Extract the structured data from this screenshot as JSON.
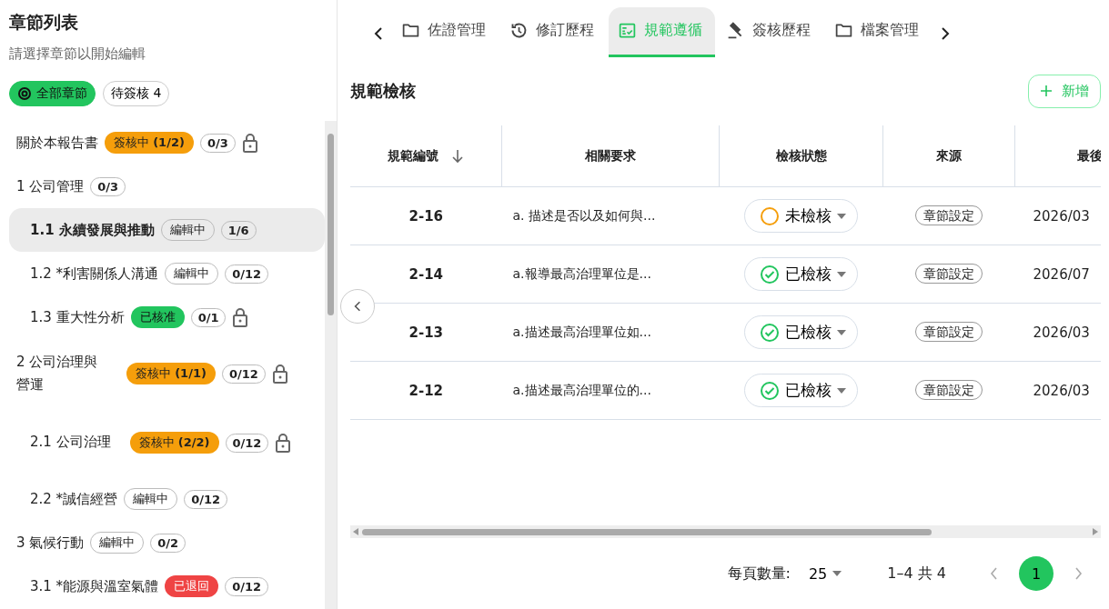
{
  "sidebar": {
    "title": "章節列表",
    "subtitle": "請選擇章節以開始編輯",
    "filters": [
      {
        "label": "全部章節",
        "selected": true
      },
      {
        "label": "待簽核 4",
        "selected": false
      }
    ],
    "items": [
      {
        "title": "關於本報告書",
        "status": {
          "kind": "signing",
          "text": "簽核中 **(1/2)**"
        },
        "count": "0/3",
        "locked": true,
        "selected": false
      },
      {
        "title": "1 公司管理",
        "count": "0/3",
        "locked": false,
        "selected": false,
        "children": [
          {
            "title": "1.1 永續發展與推動",
            "status": {
              "kind": "editing",
              "text": "編輯中"
            },
            "count": "1/6",
            "locked": false,
            "selected": true
          },
          {
            "title": "1.2 *利害關係人溝通",
            "status": {
              "kind": "editing",
              "text": "編輯中"
            },
            "count": "0/12",
            "locked": false,
            "selected": false
          },
          {
            "title": "1.3 重大性分析",
            "status": {
              "kind": "approved",
              "text": "已核准"
            },
            "count": "0/1",
            "locked": true,
            "selected": false
          }
        ]
      },
      {
        "title": "2 公司治理與營運",
        "status": {
          "kind": "signing",
          "text": "簽核中 **(1/1)**"
        },
        "count": "0/12",
        "locked": true,
        "selected": false,
        "children": [
          {
            "title": "2.1 公司治理",
            "status": {
              "kind": "signing",
              "text": "簽核中 **(2/2)**"
            },
            "count": "0/12",
            "locked": true,
            "selected": false
          },
          {
            "title": "2.2 *誠信經營",
            "status": {
              "kind": "editing",
              "text": "編輯中"
            },
            "count": "0/12",
            "locked": false,
            "selected": false
          }
        ]
      },
      {
        "title": "3 氣候行動",
        "status": {
          "kind": "editing",
          "text": "編輯中"
        },
        "count": "0/2",
        "locked": false,
        "selected": false,
        "children": [
          {
            "title": "3.1 *能源與溫室氣體",
            "status": {
              "kind": "returned",
              "text": "已退回"
            },
            "count": "0/12",
            "locked": false,
            "selected": false
          }
        ]
      }
    ]
  },
  "tabs": [
    {
      "label": "佐證管理",
      "selected": false
    },
    {
      "label": "修訂歷程",
      "selected": false
    },
    {
      "label": "規範遵循",
      "selected": true
    },
    {
      "label": "簽核歷程",
      "selected": false
    },
    {
      "label": "檔案管理",
      "selected": false
    }
  ],
  "section": {
    "title": "規範檢核",
    "add_button": "新增"
  },
  "table": {
    "columns": [
      "規範編號",
      "相關要求",
      "檢核狀態",
      "來源",
      "最後"
    ],
    "rows": [
      {
        "code": "2-16",
        "requirement": "a. 描述是否以及如何與...",
        "status": {
          "checked": false,
          "text": "未檢核"
        },
        "source": "章節設定",
        "date": "2026/03"
      },
      {
        "code": "2-14",
        "requirement": "a.報導最高治理單位是...",
        "status": {
          "checked": true,
          "text": "已檢核"
        },
        "source": "章節設定",
        "date": "2026/07"
      },
      {
        "code": "2-13",
        "requirement": "a.描述最高治理單位如...",
        "status": {
          "checked": true,
          "text": "已檢核"
        },
        "source": "章節設定",
        "date": "2026/03"
      },
      {
        "code": "2-12",
        "requirement": "a.描述最高治理單位的...",
        "status": {
          "checked": true,
          "text": "已檢核"
        },
        "source": "章節設定",
        "date": "2026/03"
      }
    ]
  },
  "pagination": {
    "per_page_label": "每頁數量:",
    "per_page": "25",
    "range": "1–4 共 4",
    "pages": [
      {
        "label": "1",
        "selected": true
      }
    ]
  }
}
